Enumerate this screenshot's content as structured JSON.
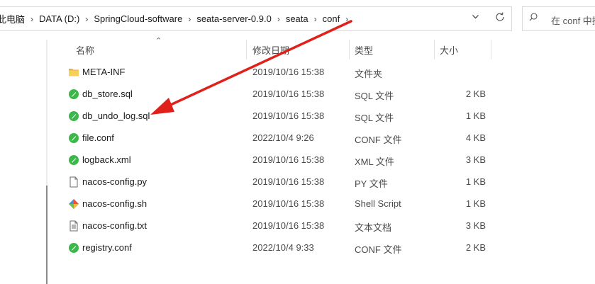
{
  "address": {
    "crumbs": [
      "此电脑",
      "DATA (D:)",
      "SpringCloud-software",
      "seata-server-0.9.0",
      "seata",
      "conf"
    ],
    "refresh_icon": "refresh-icon",
    "dropdown_icon": "chevron-down-icon"
  },
  "search": {
    "placeholder": "在 conf 中搜"
  },
  "columns": {
    "name": "名称",
    "date": "修改日期",
    "type": "类型",
    "size": "大小"
  },
  "files": [
    {
      "name": "META-INF",
      "date": "2019/10/16 15:38",
      "type": "文件夹",
      "size": "",
      "icon": "folder-icon"
    },
    {
      "name": "db_store.sql",
      "date": "2019/10/16 15:38",
      "type": "SQL 文件",
      "size": "2 KB",
      "icon": "editor-file-icon"
    },
    {
      "name": "db_undo_log.sql",
      "date": "2019/10/16 15:38",
      "type": "SQL 文件",
      "size": "1 KB",
      "icon": "editor-file-icon"
    },
    {
      "name": "file.conf",
      "date": "2022/10/4 9:26",
      "type": "CONF 文件",
      "size": "4 KB",
      "icon": "editor-file-icon"
    },
    {
      "name": "logback.xml",
      "date": "2019/10/16 15:38",
      "type": "XML 文件",
      "size": "3 KB",
      "icon": "editor-file-icon"
    },
    {
      "name": "nacos-config.py",
      "date": "2019/10/16 15:38",
      "type": "PY 文件",
      "size": "1 KB",
      "icon": "blank-file-icon"
    },
    {
      "name": "nacos-config.sh",
      "date": "2019/10/16 15:38",
      "type": "Shell Script",
      "size": "1 KB",
      "icon": "git-shell-icon"
    },
    {
      "name": "nacos-config.txt",
      "date": "2019/10/16 15:38",
      "type": "文本文档",
      "size": "3 KB",
      "icon": "text-file-icon"
    },
    {
      "name": "registry.conf",
      "date": "2022/10/4 9:33",
      "type": "CONF 文件",
      "size": "2 KB",
      "icon": "editor-file-icon"
    }
  ],
  "annotation": {
    "color": "#e0201b",
    "icon": "red-arrow"
  },
  "colors": {
    "folder": "#f4c542",
    "editor_green": "#3cb84a",
    "header_text": "#4c4c4c"
  }
}
